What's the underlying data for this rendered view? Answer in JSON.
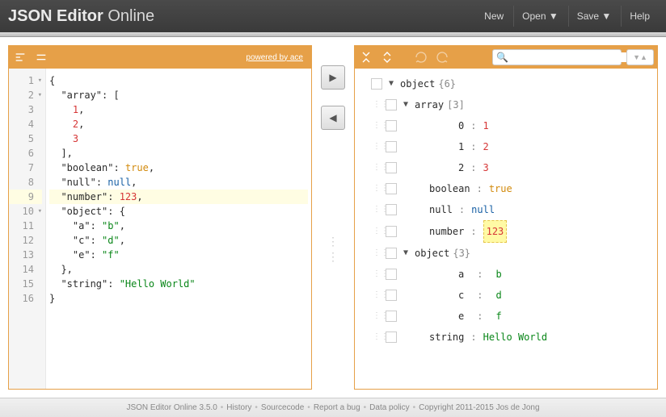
{
  "header": {
    "logo_bold": "JSON Editor",
    "logo_light": " Online",
    "menu": {
      "new": "New",
      "open": "Open ▼",
      "save": "Save ▼",
      "help": "Help"
    }
  },
  "left": {
    "powered": "powered by ace",
    "lines": {
      "l1": "{",
      "l2": "  \"array\": [",
      "l3": "    1,",
      "l4": "    2,",
      "l5": "    3",
      "l6": "  ],",
      "l7": "  \"boolean\": true,",
      "l8": "  \"null\": null,",
      "l9": "  \"number\": 123,",
      "l10": "  \"object\": {",
      "l11": "    \"a\": \"b\",",
      "l12": "    \"c\": \"d\",",
      "l13": "    \"e\": \"f\"",
      "l14": "  },",
      "l15": "  \"string\": \"Hello World\"",
      "l16": "}"
    },
    "ln": {
      "l1": "1",
      "l2": "2",
      "l3": "3",
      "l4": "4",
      "l5": "5",
      "l6": "6",
      "l7": "7",
      "l8": "8",
      "l9": "9",
      "l10": "10",
      "l11": "11",
      "l12": "12",
      "l13": "13",
      "l14": "14",
      "l15": "15",
      "l16": "16"
    }
  },
  "right": {
    "search_placeholder": "",
    "root_key": "object",
    "root_meta": "{6}",
    "array_key": "array",
    "array_meta": "[3]",
    "array_0_k": "0",
    "array_0_v": "1",
    "array_1_k": "1",
    "array_1_v": "2",
    "array_2_k": "2",
    "array_2_v": "3",
    "bool_k": "boolean",
    "bool_v": "true",
    "null_k": "null",
    "null_v": "null",
    "num_k": "number",
    "num_v": "123",
    "obj_k": "object",
    "obj_meta": "{3}",
    "obj_a_k": "a",
    "obj_a_v": "b",
    "obj_c_k": "c",
    "obj_c_v": "d",
    "obj_e_k": "e",
    "obj_e_v": "f",
    "str_k": "string",
    "str_v": "Hello World",
    "colon": ":"
  },
  "footer": {
    "name": "JSON Editor Online 3.5.0",
    "history": "History",
    "source": "Sourcecode",
    "bug": "Report a bug",
    "policy": "Data policy",
    "copyright": "Copyright 2011-2015 Jos de Jong"
  }
}
